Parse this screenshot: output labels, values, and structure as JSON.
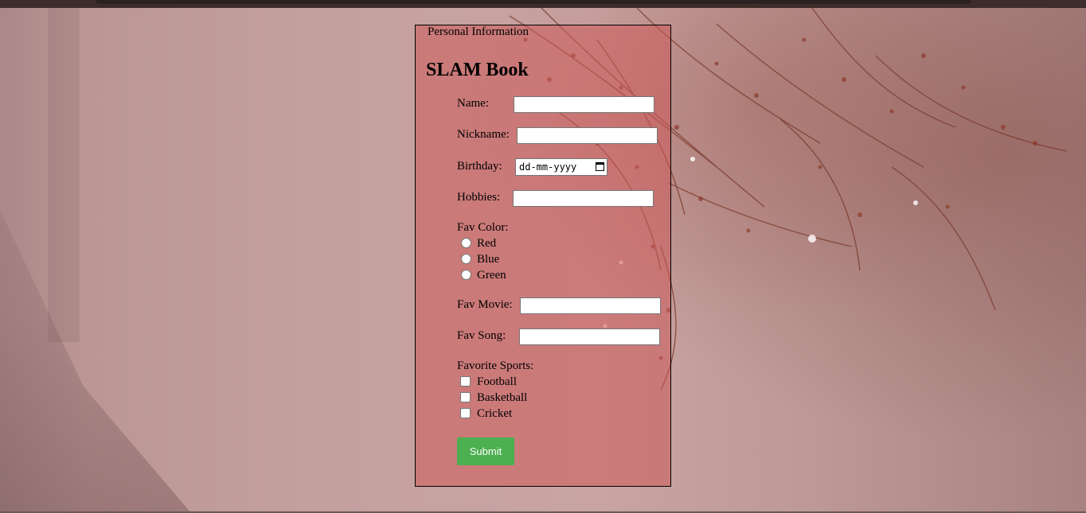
{
  "legend": "Personal Information",
  "title": "SLAM Book",
  "fields": {
    "name_label": "Name:",
    "nickname_label": "Nickname:",
    "birthday_label": "Birthday:",
    "birthday_placeholder": "dd-mm-yyyy",
    "hobbies_label": "Hobbies:",
    "fav_color_label": "Fav Color:",
    "fav_movie_label": "Fav Movie:",
    "fav_song_label": "Fav Song:",
    "sports_label": "Favorite Sports:"
  },
  "colors_options": [
    "Red",
    "Blue",
    "Green"
  ],
  "sports_options": [
    "Football",
    "Basketball",
    "Cricket"
  ],
  "submit_label": "Submit",
  "theme": {
    "panel": "#cd5a5a",
    "button": "#4caf50"
  }
}
